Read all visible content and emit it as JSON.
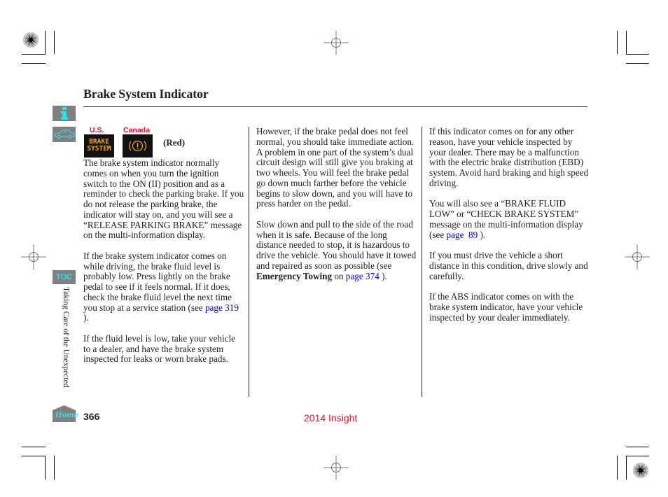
{
  "header": {
    "title": "Brake System Indicator"
  },
  "sidebar": {
    "info_icon": "info-icon",
    "car_icon": "car-icon",
    "toc_label": "TOC",
    "section_label": "Taking Care of the Unexpected",
    "home_label": "Home"
  },
  "indicators": {
    "us_label": "U.S.",
    "canada_label": "Canada",
    "us_indicator_text_line1": "BRAKE",
    "us_indicator_text_line2": "SYSTEM",
    "canada_indicator_icon": "brake-warning-icon",
    "color_note": "(Red)",
    "indicator_color": "#f5a623"
  },
  "columns": [
    {
      "paragraphs": [
        {
          "text": "The brake system indicator normally comes on when you turn the ignition switch to the ON (II) position and as a reminder to check the parking brake. If you do not release the parking brake, the indicator will stay on, and you will see a “RELEASE PARKING BRAKE” message on the multi-information display."
        },
        {
          "text_before": "If the brake system indicator comes on while driving, the brake fluid level is probably low. Press lightly on the brake pedal to see if it feels normal. If it does, check the brake fluid level the next time you stop at a service station (see ",
          "link": "page 319",
          "text_after": " )."
        },
        {
          "text": "If the fluid level is low, take your vehicle to a dealer, and have the brake system inspected for leaks or worn brake pads."
        }
      ]
    },
    {
      "paragraphs": [
        {
          "text": "However, if the brake pedal does not feel normal, you should take immediate action. A problem in one part of the system’s dual circuit design will still give you braking at two wheels. You will feel the brake pedal go down much farther before the vehicle begins to slow down, and you will have to press harder on the pedal."
        },
        {
          "text_before": "Slow down and pull to the side of the road when it is safe. Because of the long distance needed to stop, it is hazardous to drive the vehicle. You should have it towed and repaired as soon as possible (see ",
          "bold": "Emergency Towing",
          "text_mid": " on ",
          "link": "page 374",
          "text_after": " )."
        }
      ]
    },
    {
      "paragraphs": [
        {
          "text": "If this indicator comes on for any other reason, have your vehicle inspected by your dealer. There may be a malfunction with the electric brake distribution (EBD) system. Avoid hard braking and high speed driving."
        },
        {
          "text_before": "You will also see a “BRAKE FLUID LOW” or “CHECK BRAKE SYSTEM” message on the multi-information display (see ",
          "link": "page  89",
          "text_after": " )."
        },
        {
          "text": "If you must drive the vehicle a short distance in this condition, drive slowly and carefully."
        },
        {
          "text": "If the ABS indicator comes on with the brake system indicator, have your vehicle inspected by your dealer immediately."
        }
      ]
    }
  ],
  "footer": {
    "page_number": "366",
    "model": "2014 Insight"
  },
  "colors": {
    "accent_red": "#e8132a",
    "link_blue": "#0000ee",
    "sidebar_gray": "#808080",
    "sidebar_cyan": "#2de2e6"
  }
}
